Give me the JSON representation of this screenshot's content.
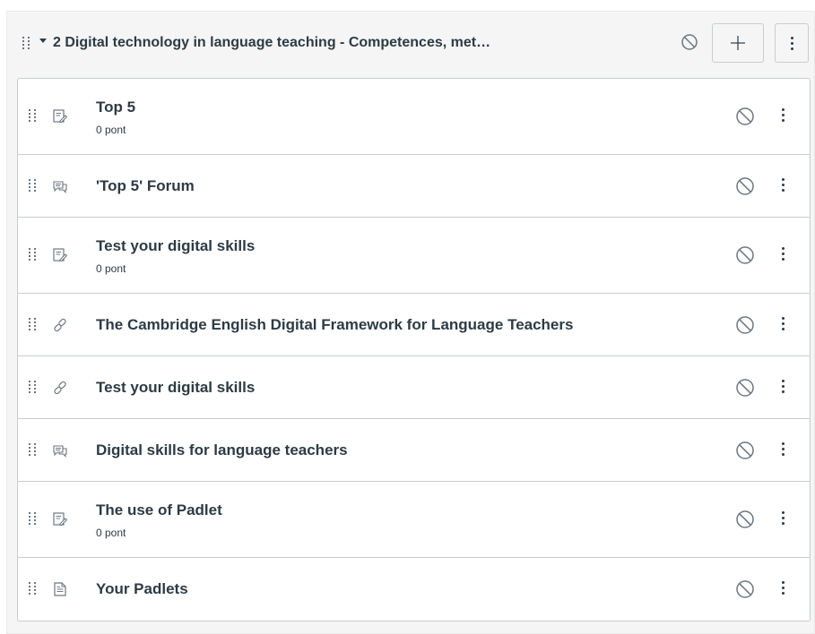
{
  "module": {
    "title": "2 Digital technology in language teaching - Competences, met…",
    "add_label": "+"
  },
  "items": [
    {
      "title": "Top 5",
      "points": "0 pont",
      "icon": "quiz-icon"
    },
    {
      "title": "'Top 5' Forum",
      "points": "",
      "icon": "discussion-icon"
    },
    {
      "title": "Test your digital skills",
      "points": "0 pont",
      "icon": "quiz-icon"
    },
    {
      "title": "The Cambridge English Digital Framework for Language Teachers",
      "points": "",
      "icon": "link-icon"
    },
    {
      "title": "Test your digital skills",
      "points": "",
      "icon": "link-icon"
    },
    {
      "title": "Digital skills for language teachers",
      "points": "",
      "icon": "discussion-icon"
    },
    {
      "title": "The use of Padlet",
      "points": "0 pont",
      "icon": "quiz-icon"
    },
    {
      "title": "Your Padlets",
      "points": "",
      "icon": "page-icon"
    }
  ],
  "colors": {
    "text": "#2d3b45",
    "border": "#c7cdd1",
    "module_bg": "#f5f5f5",
    "icon_gray": "#6b7780"
  }
}
